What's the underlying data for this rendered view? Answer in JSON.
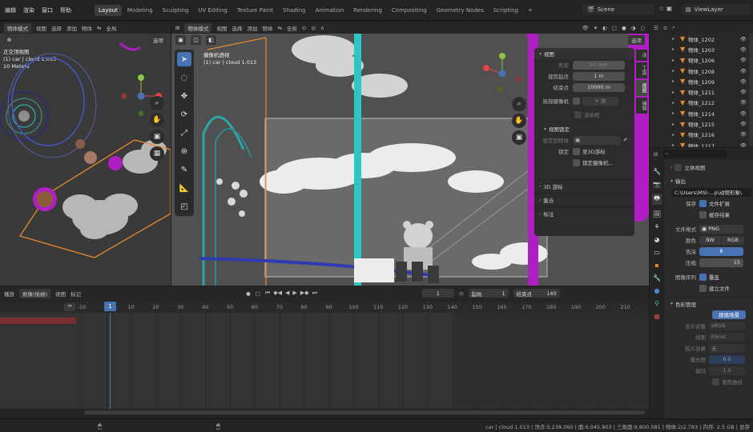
{
  "topbar": {
    "menu": [
      "编辑",
      "渲染",
      "窗口",
      "帮助"
    ],
    "workspace_tabs": [
      "Layout",
      "Modeling",
      "Sculpting",
      "UV Editing",
      "Texture Paint",
      "Shading",
      "Animation",
      "Rendering",
      "Compositing",
      "Geometry Nodes",
      "Scripting",
      "+"
    ],
    "active_tab": "Layout",
    "scene": "Scene",
    "view_layer": "ViewLayer"
  },
  "left_viewport": {
    "mode": "物体模式",
    "menu": [
      "视图",
      "选择",
      "添加",
      "物体"
    ],
    "global": "全局",
    "options": "选项",
    "overlay": [
      "正交顶视图",
      "(1) car | cloud 1.013",
      "10 Meters"
    ]
  },
  "camera_viewport": {
    "mode": "物体模式",
    "menu": [
      "视图",
      "选择",
      "添加",
      "物体"
    ],
    "global": "全局",
    "options": "选项",
    "overlay": [
      "摄像机透视",
      "(1) car | cloud 1.013"
    ]
  },
  "n_panel": {
    "title": "视图",
    "focal_label": "焦距",
    "focal_value": "50 mm",
    "clip_start_label": "裁剪起点",
    "clip_start_value": "1 m",
    "clip_end_label": "结束点",
    "clip_end_value": "10000 m",
    "local_camera_label": "局部摄像机",
    "render_region": "渲染框",
    "view_lock_title": "视图锁定",
    "lock_object_label": "锁定到物体",
    "lock_label": "锁定",
    "lock_3d_cursor": "至3D游标",
    "lock_camera": "锁定摄像机...",
    "cursor_section": "3D 游标",
    "collection_section": "集合",
    "annotation_section": "标注",
    "side_tabs": [
      "项",
      "工具",
      "视图",
      "编辑"
    ]
  },
  "outliner": {
    "items": [
      "物体_1202",
      "物体_1203",
      "物体_1206",
      "物体_1208",
      "物体_1209",
      "物体_1211",
      "物体_1212",
      "物体_1214",
      "物体_1215",
      "物体_1216",
      "物体_1217"
    ]
  },
  "properties": {
    "stereoscopy": "立体视图",
    "output_section": "输出",
    "path": "C:\\Users\\MSI-...p\\动物形象\\",
    "save_label": "保存",
    "file_ext": "文件扩展",
    "cache_result": "缓存结果",
    "file_format_label": "文件格式",
    "file_format": "PNG",
    "color_label": "颜色",
    "color_options": [
      "BW",
      "RGB"
    ],
    "depth_label": "色深",
    "depth_value": "8",
    "compression_label": "压缩",
    "compression_value": "15",
    "sequence_label": "图像序列",
    "overwrite": "覆盖",
    "placeholder": "建立文件",
    "color_mgmt_section": "色彩管理",
    "follow_scene": "跟随场景",
    "display_device_label": "显示设备",
    "display_device": "sRGB",
    "view_label": "视图",
    "view_value": "Filmic",
    "look_label": "胶片效果",
    "look_value": "无",
    "exposure_label": "曝光度",
    "exposure_value": "0.0",
    "gamma_label": "伽玛",
    "gamma_value": "1.0",
    "use_curves": "使用曲线"
  },
  "timeline": {
    "menu": [
      "播放",
      "抠像(插帧)",
      "视图",
      "标记"
    ],
    "current_frame": "1",
    "start_label": "起始",
    "start": "1",
    "end_label": "结束点",
    "end": "140",
    "ruler": [
      "-10",
      "1",
      "10",
      "20",
      "30",
      "40",
      "50",
      "60",
      "70",
      "80",
      "90",
      "100",
      "110",
      "120",
      "130",
      "140",
      "150",
      "160",
      "170",
      "180",
      "190",
      "200",
      "210"
    ]
  },
  "statusbar": {
    "text": "car | cloud 1.013 | 顶点:5,238,060 | 面:6,045,803 | 三角面:9,800,581 | 物体:2/2,783 | 内存: 2.5 GB | 显存"
  },
  "colors": {
    "accent": "#4772b3",
    "magenta": "#b01fc4",
    "teal": "#2ec6c4",
    "orange": "#e58a2c",
    "keyframe_red": "#7a2e2e"
  }
}
